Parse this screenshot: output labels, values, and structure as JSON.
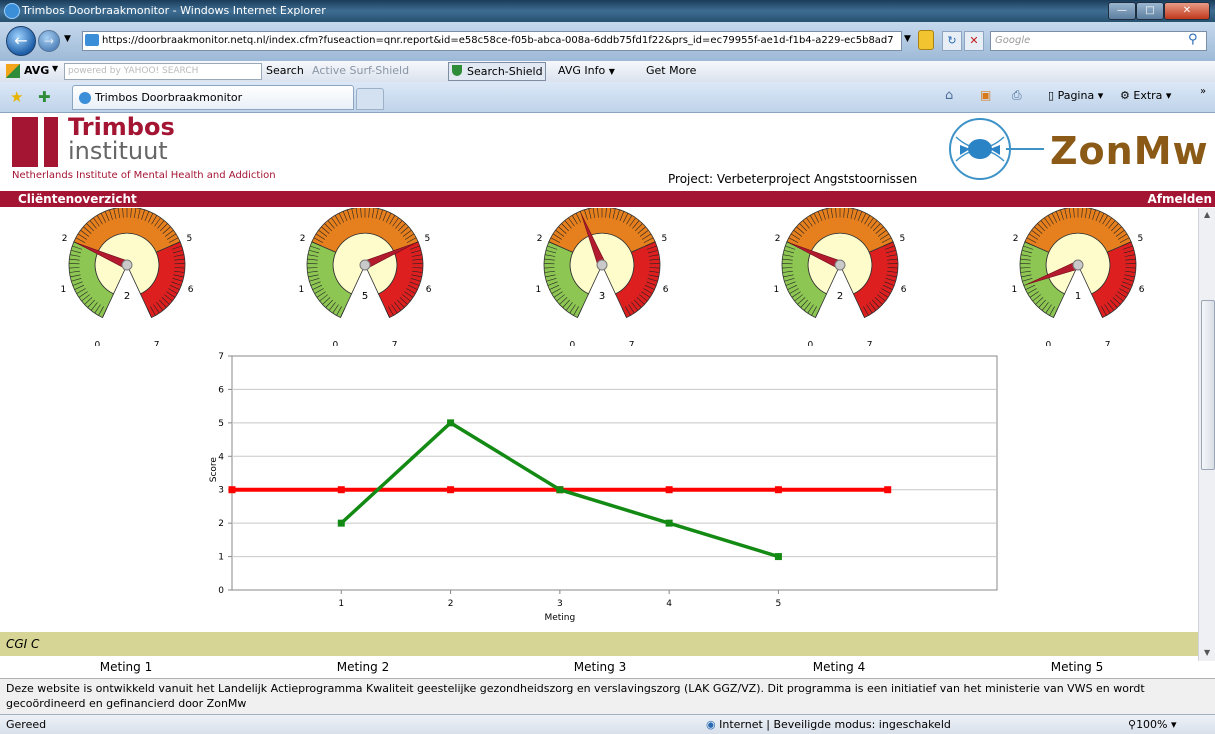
{
  "window": {
    "title": "Trimbos Doorbraakmonitor - Windows Internet Explorer",
    "url": "https://doorbraakmonitor.netq.nl/index.cfm?fuseaction=qnr.report&id=e58c58ce-f05b-abca-008a-6ddb75fd1f22&prs_id=ec79955f-ae1d-f1b4-a229-ec5b8ad7",
    "search_placeholder": "Google"
  },
  "avg_toolbar": {
    "brand": "AVG",
    "search_field": "powered by YAHOO! SEARCH",
    "search_button": "Search",
    "active_surf": "Active Surf-Shield",
    "search_shield": "Search-Shield",
    "avg_info": "AVG Info",
    "get_more": "Get More"
  },
  "tabs": {
    "active": "Trimbos Doorbraakmonitor",
    "command_pagina": "Pagina",
    "command_extra": "Extra"
  },
  "header": {
    "logo_line1": "Trimbos",
    "logo_line2": "instituut",
    "logo_sub": "Netherlands Institute of Mental Health and Addiction",
    "project": "Project: Verbeterproject Angststoornissen",
    "partner_logo": "ZonMw"
  },
  "redbar": {
    "left": "Cliëntenoverzicht",
    "right": "Afmelden"
  },
  "gauges": [
    {
      "value": 2,
      "value_text": "2"
    },
    {
      "value": 5,
      "value_text": "5"
    },
    {
      "value": 3,
      "value_text": "3"
    },
    {
      "value": 2,
      "value_text": "2"
    },
    {
      "value": 1,
      "value_text": "1"
    }
  ],
  "gauge_ticks": [
    "0",
    "1",
    "2",
    "5",
    "6",
    "7"
  ],
  "chart_data": {
    "type": "line",
    "xlabel": "Meting",
    "ylabel": "Score",
    "ylim": [
      0,
      7
    ],
    "yticks": [
      "0",
      "1",
      "2",
      "3",
      "4",
      "5",
      "6",
      "7"
    ],
    "xticks": [
      "1",
      "2",
      "3",
      "4",
      "5"
    ],
    "grid": true,
    "series": [
      {
        "color": "#ff0000",
        "x": [
          0,
          1,
          2,
          3,
          4,
          5,
          6
        ],
        "values": [
          3,
          3,
          3,
          3,
          3,
          3,
          3
        ]
      },
      {
        "color": "#138a13",
        "x": [
          1,
          2,
          3,
          4,
          5
        ],
        "values": [
          2,
          5,
          3,
          2,
          1
        ]
      }
    ]
  },
  "cgi": {
    "label": "CGI C",
    "columns": [
      "Meting 1",
      "Meting 2",
      "Meting 3",
      "Meting 4",
      "Meting 5"
    ]
  },
  "footer": {
    "text": "Deze website is ontwikkeld vanuit het Landelijk Actieprogramma Kwaliteit geestelijke gezondheidszorg en verslavingszorg (LAK GGZ/VZ). Dit programma is een initiatief van het ministerie van VWS en wordt gecoördineerd en gefinancierd door ZonMw"
  },
  "status": {
    "left": "Gereed",
    "zone": "Internet | Beveiligde modus: ingeschakeld",
    "zoom": "100%"
  },
  "colors": {
    "brand_red": "#a41533",
    "cgi_band": "#d6d595",
    "zonmw_brown": "#8a5a16"
  }
}
